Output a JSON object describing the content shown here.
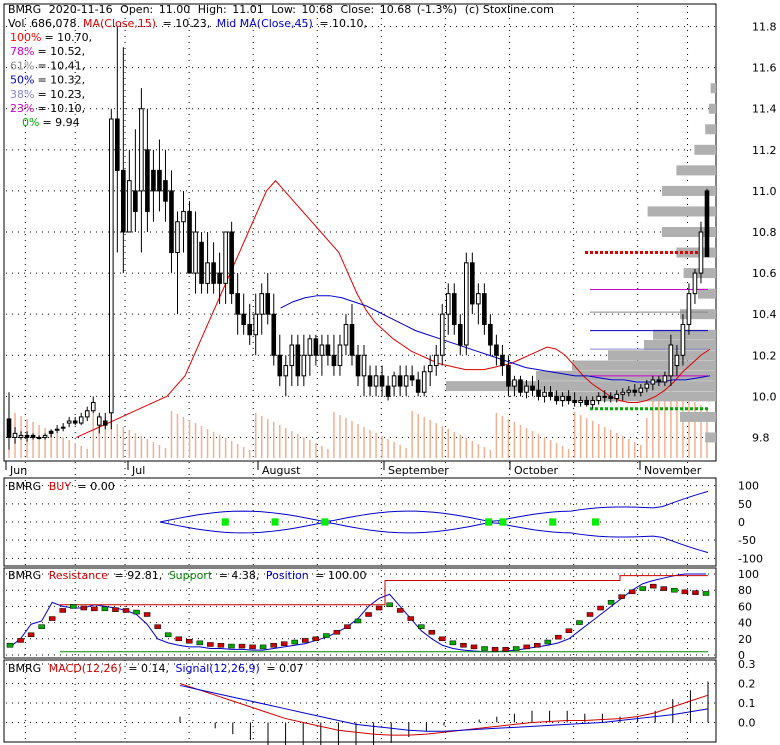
{
  "header": {
    "symbol": "BMRG",
    "date": "2020-11-16",
    "open_label": "Open:",
    "open": "11.00",
    "high_label": "High:",
    "high": "11.01",
    "low_label": "Low:",
    "low": "10.68",
    "close_label": "Close:",
    "close": "10.68",
    "change": "(-1.3%)",
    "source": "(c) Stoxline.com",
    "vol_label": "Vol",
    "vol": "686,078",
    "ma_label": "MA(Close,15)",
    "ma_value": "= 10.23,",
    "mid_label": "Mid MA(Close,45)",
    "mid_value": "= 10.10,"
  },
  "fib_levels": [
    {
      "label": "100%",
      "value": "= 10.70,",
      "color": "#ff0000"
    },
    {
      "label": "78%",
      "value": "= 10.52,",
      "color": "#cc00cc"
    },
    {
      "label": "61%",
      "value": "= 10.41,",
      "color": "#888888"
    },
    {
      "label": "50%",
      "value": "= 10.32,",
      "color": "#0000cc"
    },
    {
      "label": "38%",
      "value": "= 10.23,",
      "color": "#8888cc"
    },
    {
      "label": "23%",
      "value": "= 10.10,",
      "color": "#cc00cc"
    },
    {
      "label": "0%",
      "value": "= 9.94",
      "color": "#00aa00"
    }
  ],
  "x_labels": [
    "Jun",
    "Jul",
    "August",
    "September",
    "October",
    "November"
  ],
  "buy_panel": {
    "label": "BMRG",
    "buy_label": "BUY",
    "buy_value": "= 0.00",
    "ticks": [
      "100",
      "50",
      "0",
      "-50",
      "-100"
    ]
  },
  "res_panel": {
    "label": "BMRG",
    "resistance_label": "Resistance",
    "resistance_value": "= 92.81,",
    "support_label": "Support",
    "support_value": "= 4.38,",
    "position_label": "Position",
    "position_value": "= 100.00",
    "ticks": [
      "100",
      "80",
      "60",
      "40",
      "20",
      "0"
    ]
  },
  "macd_panel": {
    "label": "BMRG",
    "macd_label": "MACD(12,26)",
    "macd_value": "= 0.14,",
    "signal_label": "Signal(12,26,9)",
    "signal_value": "= 0.07",
    "ticks": [
      "0.3",
      "0.2",
      "0.1",
      "0.0"
    ]
  },
  "colors": {
    "up": "#ffffff",
    "down": "#000000",
    "ma15": "#dd0000",
    "ma45": "#0000cc",
    "volume": "#f0b090",
    "profile": "#b0b0b0",
    "buy_marker": "#00ee00",
    "resistance": "#cc0000",
    "support": "#008800",
    "position": "#0000cc",
    "macd": "#cc0000",
    "signal": "#0000cc"
  },
  "chart_data": {
    "type": "candlestick",
    "ylim": [
      9.7,
      11.9
    ],
    "y_ticks": [
      9.8,
      10.0,
      10.2,
      10.4,
      10.6,
      10.8,
      11.0,
      11.2,
      11.4,
      11.6,
      11.8
    ],
    "candles": [
      [
        9.89,
        10.02,
        9.74,
        9.8
      ],
      [
        9.8,
        9.85,
        9.77,
        9.82
      ],
      [
        9.8,
        9.83,
        9.79,
        9.81
      ],
      [
        9.81,
        9.83,
        9.78,
        9.8
      ],
      [
        9.81,
        9.82,
        9.79,
        9.8
      ],
      [
        9.8,
        9.81,
        9.79,
        9.8
      ],
      [
        9.8,
        9.82,
        9.79,
        9.81
      ],
      [
        9.83,
        9.84,
        9.8,
        9.82
      ],
      [
        9.84,
        9.86,
        9.82,
        9.84
      ],
      [
        9.85,
        9.87,
        9.83,
        9.85
      ],
      [
        9.87,
        9.9,
        9.85,
        9.88
      ],
      [
        9.88,
        9.9,
        9.86,
        9.87
      ],
      [
        9.87,
        9.92,
        9.86,
        9.9
      ],
      [
        9.9,
        9.95,
        9.88,
        9.93
      ],
      [
        9.93,
        10.0,
        9.92,
        9.97
      ],
      [
        9.86,
        9.92,
        9.82,
        9.9
      ],
      [
        9.88,
        9.92,
        9.84,
        9.86
      ],
      [
        9.92,
        11.4,
        9.84,
        11.35
      ],
      [
        11.35,
        11.8,
        10.7,
        11.1
      ],
      [
        11.1,
        11.7,
        10.6,
        10.8
      ],
      [
        10.8,
        11.2,
        10.9,
        11.05
      ],
      [
        11.0,
        11.3,
        10.8,
        10.9
      ],
      [
        11.0,
        11.5,
        10.7,
        11.4
      ],
      [
        11.2,
        11.4,
        10.8,
        10.9
      ],
      [
        11.1,
        11.2,
        10.85,
        11.0
      ],
      [
        11.1,
        11.25,
        10.9,
        11.0
      ],
      [
        11.05,
        11.2,
        10.85,
        10.95
      ],
      [
        11.0,
        11.1,
        10.6,
        10.7
      ],
      [
        10.7,
        10.9,
        10.4,
        10.85
      ],
      [
        10.85,
        11.0,
        10.7,
        10.9
      ],
      [
        10.9,
        10.95,
        10.6,
        10.6
      ],
      [
        10.6,
        10.9,
        10.5,
        10.8
      ],
      [
        10.75,
        10.8,
        10.5,
        10.55
      ],
      [
        10.55,
        10.8,
        10.5,
        10.65
      ],
      [
        10.65,
        10.75,
        10.5,
        10.55
      ],
      [
        10.6,
        10.7,
        10.45,
        10.55
      ],
      [
        10.55,
        10.8,
        10.45,
        10.8
      ],
      [
        10.8,
        10.85,
        10.45,
        10.5
      ],
      [
        10.5,
        10.6,
        10.3,
        10.4
      ],
      [
        10.4,
        10.5,
        10.3,
        10.35
      ],
      [
        10.35,
        10.45,
        10.25,
        10.3
      ],
      [
        10.3,
        10.5,
        10.2,
        10.4
      ],
      [
        10.4,
        10.55,
        10.3,
        10.5
      ],
      [
        10.5,
        10.6,
        10.35,
        10.4
      ],
      [
        10.4,
        10.5,
        10.15,
        10.2
      ],
      [
        10.2,
        10.3,
        10.05,
        10.1
      ],
      [
        10.1,
        10.2,
        10.0,
        10.15
      ],
      [
        10.15,
        10.3,
        10.05,
        10.25
      ],
      [
        10.25,
        10.3,
        10.05,
        10.1
      ],
      [
        10.1,
        10.3,
        10.05,
        10.2
      ],
      [
        10.2,
        10.3,
        10.1,
        10.28
      ],
      [
        10.28,
        10.3,
        10.15,
        10.2
      ],
      [
        10.2,
        10.3,
        10.1,
        10.25
      ],
      [
        10.25,
        10.3,
        10.15,
        10.2
      ],
      [
        10.2,
        10.3,
        10.1,
        10.15
      ],
      [
        10.15,
        10.3,
        10.1,
        10.25
      ],
      [
        10.25,
        10.4,
        10.2,
        10.35
      ],
      [
        10.35,
        10.45,
        10.15,
        10.2
      ],
      [
        10.2,
        10.25,
        10.05,
        10.1
      ],
      [
        10.1,
        10.25,
        10.0,
        10.2
      ],
      [
        10.1,
        10.15,
        10.0,
        10.05
      ],
      [
        10.05,
        10.15,
        10.0,
        10.1
      ],
      [
        10.1,
        10.15,
        10.0,
        10.05
      ],
      [
        10.05,
        10.1,
        9.98,
        10.0
      ],
      [
        10.05,
        10.12,
        10.0,
        10.1
      ],
      [
        10.1,
        10.15,
        10.0,
        10.05
      ],
      [
        10.05,
        10.15,
        10.0,
        10.1
      ],
      [
        10.1,
        10.15,
        10.05,
        10.08
      ],
      [
        10.08,
        10.12,
        10.0,
        10.02
      ],
      [
        10.02,
        10.15,
        10.0,
        10.12
      ],
      [
        10.12,
        10.2,
        10.05,
        10.15
      ],
      [
        10.15,
        10.25,
        10.1,
        10.2
      ],
      [
        10.2,
        10.45,
        10.15,
        10.4
      ],
      [
        10.4,
        10.55,
        10.3,
        10.5
      ],
      [
        10.5,
        10.55,
        10.3,
        10.35
      ],
      [
        10.35,
        10.4,
        10.2,
        10.25
      ],
      [
        10.25,
        10.7,
        10.2,
        10.65
      ],
      [
        10.65,
        10.7,
        10.4,
        10.45
      ],
      [
        10.45,
        10.55,
        10.35,
        10.5
      ],
      [
        10.5,
        10.55,
        10.3,
        10.35
      ],
      [
        10.35,
        10.4,
        10.2,
        10.25
      ],
      [
        10.25,
        10.3,
        10.15,
        10.2
      ],
      [
        10.2,
        10.25,
        10.1,
        10.15
      ],
      [
        10.15,
        10.2,
        10.0,
        10.05
      ],
      [
        10.05,
        10.1,
        10.0,
        10.08
      ],
      [
        10.08,
        10.1,
        10.0,
        10.02
      ],
      [
        10.02,
        10.08,
        9.99,
        10.05
      ],
      [
        10.05,
        10.1,
        10.0,
        10.03
      ],
      [
        10.03,
        10.08,
        9.98,
        10.0
      ],
      [
        10.0,
        10.05,
        9.97,
        10.02
      ],
      [
        10.02,
        10.05,
        9.98,
        10.0
      ],
      [
        10.0,
        10.03,
        9.96,
        9.98
      ],
      [
        9.98,
        10.02,
        9.95,
        10.0
      ],
      [
        10.0,
        10.03,
        9.96,
        9.98
      ],
      [
        9.98,
        10.02,
        9.95,
        9.97
      ],
      [
        9.97,
        10.0,
        9.95,
        9.98
      ],
      [
        9.98,
        10.0,
        9.95,
        9.96
      ],
      [
        9.96,
        10.0,
        9.94,
        9.98
      ],
      [
        9.98,
        10.02,
        9.96,
        10.0
      ],
      [
        10.0,
        10.03,
        9.97,
        10.0
      ],
      [
        10.0,
        10.02,
        9.97,
        9.99
      ],
      [
        9.99,
        10.03,
        9.97,
        10.01
      ],
      [
        10.01,
        10.04,
        9.98,
        10.02
      ],
      [
        10.02,
        10.05,
        10.0,
        10.03
      ],
      [
        10.03,
        10.06,
        10.0,
        10.02
      ],
      [
        10.02,
        10.06,
        10.0,
        10.04
      ],
      [
        10.04,
        10.08,
        10.02,
        10.06
      ],
      [
        10.06,
        10.1,
        10.03,
        10.08
      ],
      [
        10.08,
        10.1,
        10.05,
        10.07
      ],
      [
        10.07,
        10.12,
        10.05,
        10.1
      ],
      [
        10.1,
        10.3,
        10.05,
        10.25
      ],
      [
        10.15,
        10.25,
        10.1,
        10.2
      ],
      [
        10.2,
        10.4,
        10.15,
        10.35
      ],
      [
        10.35,
        10.55,
        10.3,
        10.5
      ],
      [
        10.5,
        10.62,
        10.45,
        10.6
      ],
      [
        10.6,
        10.85,
        10.55,
        10.8
      ],
      [
        11.0,
        11.01,
        10.68,
        10.68
      ]
    ],
    "ma15": [
      9.8,
      9.82,
      9.84,
      9.86,
      9.88,
      9.9,
      9.92,
      9.94,
      9.96,
      9.98,
      10.0,
      10.05,
      10.1,
      10.2,
      10.3,
      10.4,
      10.5,
      10.6,
      10.7,
      10.8,
      10.9,
      11.0,
      11.05,
      11.0,
      10.95,
      10.9,
      10.85,
      10.8,
      10.75,
      10.7,
      10.6,
      10.5,
      10.42,
      10.36,
      10.32,
      10.28,
      10.25,
      10.22,
      10.2,
      10.18,
      10.16,
      10.15,
      10.14,
      10.13,
      10.13,
      10.13,
      10.14,
      10.15,
      10.16,
      10.18,
      10.2,
      10.22,
      10.24,
      10.23,
      10.2,
      10.15,
      10.1,
      10.06,
      10.03,
      10.0,
      9.98,
      9.97,
      9.97,
      9.98,
      10.0,
      10.03,
      10.07,
      10.12,
      10.16,
      10.2,
      10.23
    ],
    "ma45": [
      10.43,
      10.46,
      10.48,
      10.49,
      10.49,
      10.48,
      10.46,
      10.44,
      10.41,
      10.38,
      10.35,
      10.32,
      10.3,
      10.28,
      10.26,
      10.24,
      10.22,
      10.2,
      10.18,
      10.16,
      10.14,
      10.13,
      10.12,
      10.11,
      10.1,
      10.1,
      10.09,
      10.08,
      10.08,
      10.07,
      10.07,
      10.07,
      10.08,
      10.08,
      10.09,
      10.1
    ],
    "buy_signal": {
      "ylim": [
        -110,
        110
      ],
      "markers_x": [
        0.31,
        0.38,
        0.45,
        0.68,
        0.7,
        0.77,
        0.83
      ]
    },
    "resistance": [
      10,
      20,
      38,
      42,
      65,
      60,
      58,
      58,
      62,
      60,
      58,
      55,
      50,
      38,
      20,
      15,
      12,
      10,
      10,
      8,
      8,
      7,
      7,
      6,
      6,
      8,
      10,
      12,
      14,
      18,
      22,
      28,
      35,
      45,
      60,
      70,
      75,
      60,
      45,
      30,
      20,
      12,
      8,
      6,
      5,
      4,
      4,
      5,
      6,
      8,
      10,
      12,
      15,
      20,
      30,
      40,
      50,
      60,
      70,
      80,
      88,
      92,
      95,
      98,
      100,
      100,
      100
    ],
    "position": [
      12,
      18,
      25,
      35,
      45,
      55,
      60,
      58,
      57,
      57,
      56,
      55,
      53,
      50,
      35,
      25,
      20,
      17,
      15,
      13,
      12,
      11,
      11,
      10,
      10,
      12,
      14,
      16,
      18,
      20,
      24,
      28,
      35,
      42,
      50,
      58,
      62,
      55,
      45,
      35,
      28,
      20,
      15,
      12,
      10,
      8,
      7,
      7,
      8,
      10,
      12,
      16,
      22,
      30,
      40,
      50,
      58,
      65,
      72,
      78,
      82,
      85,
      82,
      80,
      78,
      77,
      76
    ],
    "macd": [
      0.2,
      0.17,
      0.14,
      0.11,
      0.08,
      0.05,
      0.02,
      0.0,
      -0.02,
      -0.04,
      -0.05,
      -0.06,
      -0.065,
      -0.065,
      -0.06,
      -0.05,
      -0.04,
      -0.03,
      -0.02,
      -0.01,
      0.0,
      0.005,
      0.01,
      0.01,
      0.015,
      0.02,
      0.03,
      0.05,
      0.08,
      0.11,
      0.14
    ],
    "signal": [
      0.19,
      0.17,
      0.15,
      0.13,
      0.11,
      0.09,
      0.07,
      0.05,
      0.03,
      0.01,
      -0.01,
      -0.02,
      -0.03,
      -0.04,
      -0.045,
      -0.045,
      -0.04,
      -0.035,
      -0.03,
      -0.025,
      -0.02,
      -0.015,
      -0.01,
      -0.005,
      0.0,
      0.01,
      0.02,
      0.03,
      0.04,
      0.055,
      0.07
    ]
  }
}
